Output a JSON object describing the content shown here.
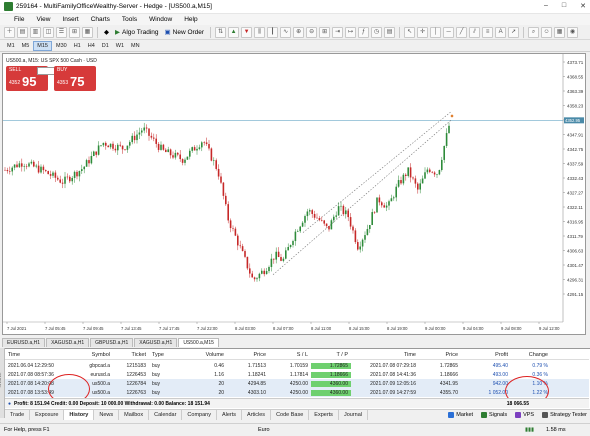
{
  "window": {
    "title": "259164 - MultiFamilyOfficeWealthy-Server - Hedge - [US500.a,M15]",
    "buttons": [
      "–",
      "□",
      "✕"
    ]
  },
  "menu": [
    "File",
    "View",
    "Insert",
    "Charts",
    "Tools",
    "Window",
    "Help"
  ],
  "toolbar": {
    "algo_trading": "Algo Trading",
    "new_order": "New Order"
  },
  "timeframes": [
    "M1",
    "M5",
    "M15",
    "M30",
    "H1",
    "H4",
    "D1",
    "W1",
    "MN"
  ],
  "active_timeframe": "M15",
  "chart": {
    "symbol_label": "US500.a, M15: US SPX 500 Cash · USD",
    "one_click": {
      "sell": "SELL",
      "buy": "BUY",
      "volume": "20",
      "sell_price_small": "4352",
      "sell_price_big": "95",
      "buy_price_small": "4353",
      "buy_price_big": "75"
    },
    "price_ticks": [
      "4373.71",
      "4368.55",
      "4363.39",
      "4358.23",
      "4353.07",
      "4347.91",
      "4342.75",
      "4337.59",
      "4332.43",
      "4327.27",
      "4322.11",
      "4316.95",
      "4311.79",
      "4306.63",
      "4301.47",
      "4296.31",
      "4291.15"
    ],
    "current_price_label": "4352.95",
    "time_ticks": [
      "7 Jul 2021",
      "7 Jul 05:45",
      "7 Jul 09:45",
      "7 Jul 13:45",
      "7 Jul 17:45",
      "7 Jul 22:00",
      "8 Jul 03:00",
      "8 Jul 07:00",
      "8 Jul 11:00",
      "8 Jul 15:00",
      "8 Jul 19:00",
      "9 Jul 00:00",
      "9 Jul 04:00",
      "9 Jul 08:00",
      "9 Jul 12:00"
    ],
    "up_color": "#2e8b3a",
    "down_color": "#c62828"
  },
  "chart_tabs": [
    "EURUSD.a,H1",
    "XAGUSD.a,H1",
    "GBPUSD.a,H1",
    "XAGUSD.a,H1",
    "US500.a,M15"
  ],
  "active_chart_tab": "US500.a,M15",
  "history": {
    "columns": [
      "Time",
      "Symbol",
      "Ticket",
      "Type",
      "Volume",
      "Price",
      "S / L",
      "T / P",
      "Time",
      "Price",
      "Profit",
      "Change"
    ],
    "rows": [
      [
        "2021.06.04 12:29:50",
        "gbpcad.a",
        "1215183",
        "buy",
        "0.46",
        "1.71513",
        "1.70159",
        "1.72865",
        "2021.07.08 07:29:18",
        "1.72865",
        "495.40",
        "0.79 %"
      ],
      [
        "2021.07.08 08:57:36",
        "eurusd.a",
        "1226453",
        "buy",
        "1.16",
        "1.18241",
        "1.17814",
        "1.18666",
        "2021.07.08 14:41:36",
        "1.18666",
        "493.00",
        "0.36 %"
      ],
      [
        "2021.07.08 14:20:08",
        "us500.a",
        "1226784",
        "buy",
        "20",
        "4294.85",
        "4250.00",
        "4360.00",
        "2021.07.09 12:05:16",
        "4341.95",
        "942.00",
        "1.10 %"
      ],
      [
        "2021.07.08 13:53:49",
        "us500.a",
        "1226763",
        "buy",
        "20",
        "4303.10",
        "4250.00",
        "4360.00",
        "2021.07.09 14:27:59",
        "4355.70",
        "1 052.00",
        "1.22 %"
      ]
    ],
    "summary": "Profit: 8 151.94  Credit: 0.00  Deposit: 10 000.00  Withdrawal: 0.00  Balance: 18 151.94",
    "total": "18 066.55"
  },
  "bottom_tabs": [
    "Trade",
    "Exposure",
    "History",
    "News",
    "Mailbox",
    "Calendar",
    "Company",
    "Alerts",
    "Articles",
    "Code Base",
    "Experts",
    "Journal"
  ],
  "active_bottom_tab": "History",
  "right_buttons": [
    "Market",
    "Signals",
    "VPS",
    "Strategy Tester"
  ],
  "side_label": "Toolbox",
  "status": {
    "help": "For Help, press F1",
    "profile": "Euro",
    "ping": "1.58 ms"
  }
}
